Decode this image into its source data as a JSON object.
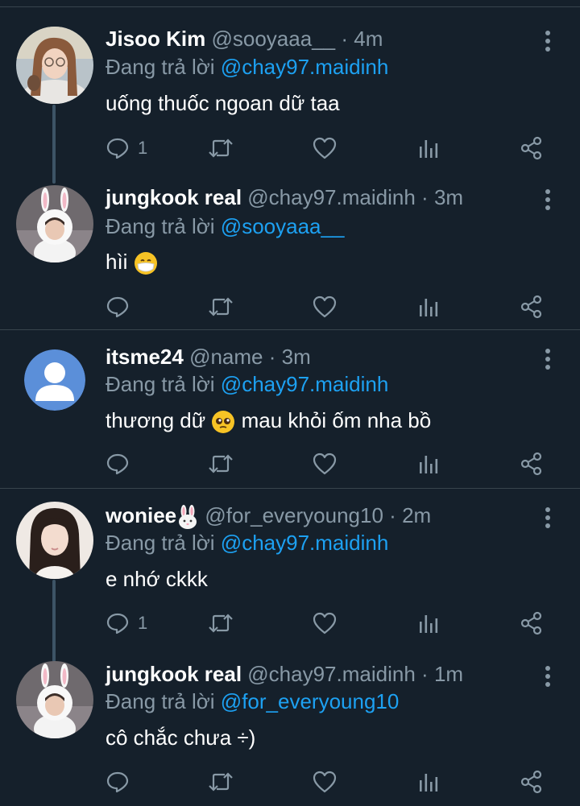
{
  "replying_prefix": "Đang trả lời",
  "tweets": [
    {
      "name": "Jisoo Kim",
      "handle": "@sooyaaa__",
      "dot": "·",
      "time": "4m",
      "reply_to": "@chay97.maidinh",
      "text": "uống thuốc ngoan dữ taa",
      "reply_count": "1"
    },
    {
      "name": "jungkook real",
      "handle": "@chay97.maidinh",
      "dot": "·",
      "time": "3m",
      "reply_to": "@sooyaaa__",
      "text": "hìi",
      "reply_count": ""
    },
    {
      "name": "itsme24",
      "handle": "@name",
      "dot": "·",
      "time": "3m",
      "reply_to": "@chay97.maidinh",
      "text_before": "thương dữ",
      "text_after": "mau khỏi ốm nha bồ",
      "reply_count": ""
    },
    {
      "name": "woniee",
      "handle": "@for_everyoung10",
      "dot": "·",
      "time": "2m",
      "reply_to": "@chay97.maidinh",
      "text": "e nhớ ckkk",
      "reply_count": "1"
    },
    {
      "name": "jungkook real",
      "handle": "@chay97.maidinh",
      "dot": "·",
      "time": "1m",
      "reply_to": "@for_everyoung10",
      "text": "cô chắc chưa ÷)",
      "reply_count": ""
    }
  ],
  "icons": {
    "reply": "reply-icon",
    "retweet": "retweet-icon",
    "like": "heart-icon",
    "analytics": "analytics-icon",
    "share": "share-icon",
    "more": "more-vertical-icon"
  },
  "colors": {
    "background": "#15202b",
    "divider": "#38444d",
    "text": "#ffffff",
    "muted": "#8899a6",
    "mention": "#1da1f2",
    "thread_line": "#3d5466"
  }
}
